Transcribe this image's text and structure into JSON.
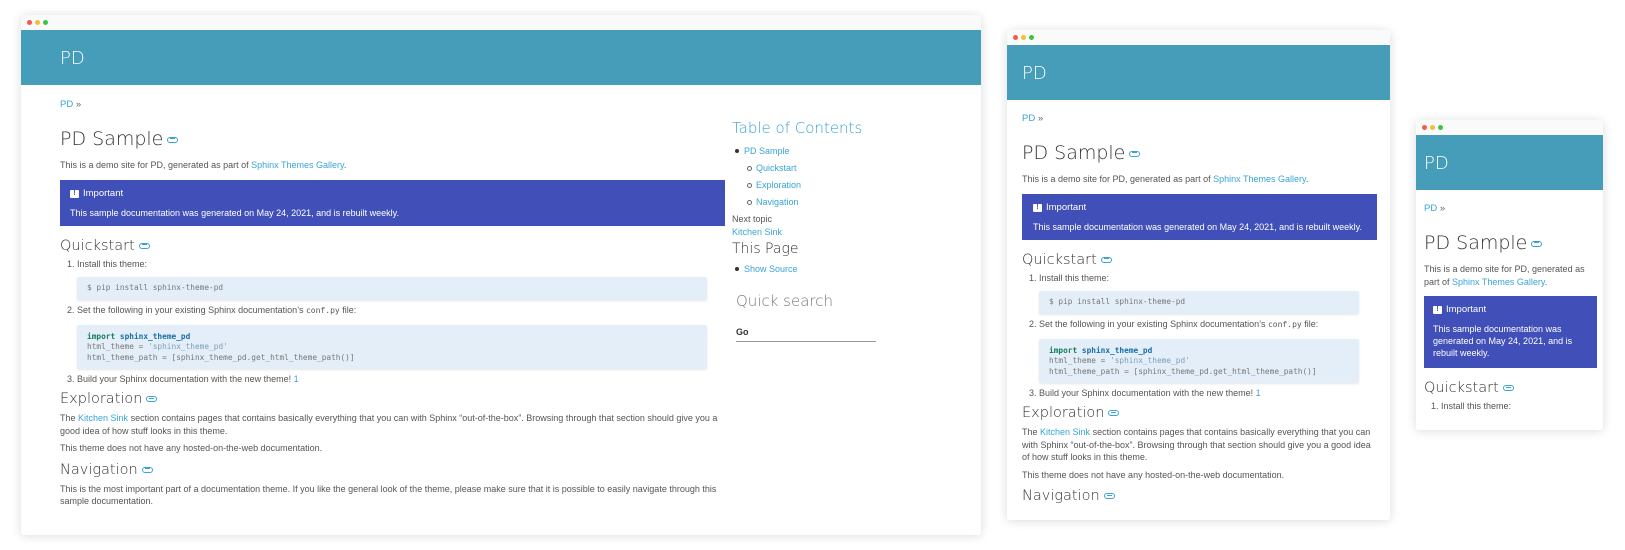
{
  "site": {
    "title": "PD",
    "breadcrumb": "PD",
    "breadcrumb_sep": "»"
  },
  "page": {
    "h1": "PD Sample",
    "intro_prefix": "This is a demo site for PD, generated as part of",
    "intro_link": "Sphinx Themes Gallery",
    "intro_suffix": ".",
    "admonition_title": "Important",
    "admonition_text": "This sample documentation was generated on May 24, 2021, and is rebuilt weekly.",
    "quickstart_h": "Quickstart",
    "step1": "Install this theme:",
    "code1": "$ pip install sphinx-theme-pd",
    "step2_prefix": "Set the following in your existing Sphinx documentation’s",
    "step2_code": "conf.py",
    "step2_suffix": "file:",
    "code2_import": "import",
    "code2_module": "sphinx_theme_pd",
    "code2_line2_a": "html_theme = ",
    "code2_line2_b": "'sphinx_theme_pd'",
    "code2_line3": "html_theme_path = [sphinx_theme_pd.get_html_theme_path()]",
    "step3": "Build your Sphinx documentation with the new theme!",
    "step3_footnote": "1",
    "exploration_h": "Exploration",
    "exploration_prefix": "The",
    "exploration_link": "Kitchen Sink",
    "exploration_suffix": "section contains pages that contains basically everything that you can with Sphinx “out-of-the-box”. Browsing through that section should give you a good idea of how stuff looks in this theme.",
    "hosted_text": "This theme does not have any hosted-on-the-web documentation.",
    "navigation_h": "Navigation",
    "navigation_text": "This is the most important part of a documentation theme. If you like the general look of the theme, please make sure that it is possible to easily navigate through this sample documentation."
  },
  "sidebar": {
    "toc_title": "Table of Contents",
    "toc_root": "PD Sample",
    "toc_children": [
      "Quickstart",
      "Exploration",
      "Navigation"
    ],
    "next_label": "Next topic",
    "next_link": "Kitchen Sink",
    "this_page": "This Page",
    "show_source": "Show Source",
    "quick_search": "Quick search",
    "go": "Go"
  },
  "colors": {
    "header": "#459db9",
    "link": "#38a4d6",
    "admonition": "#4150b9",
    "code_bg": "#e3eef8"
  }
}
